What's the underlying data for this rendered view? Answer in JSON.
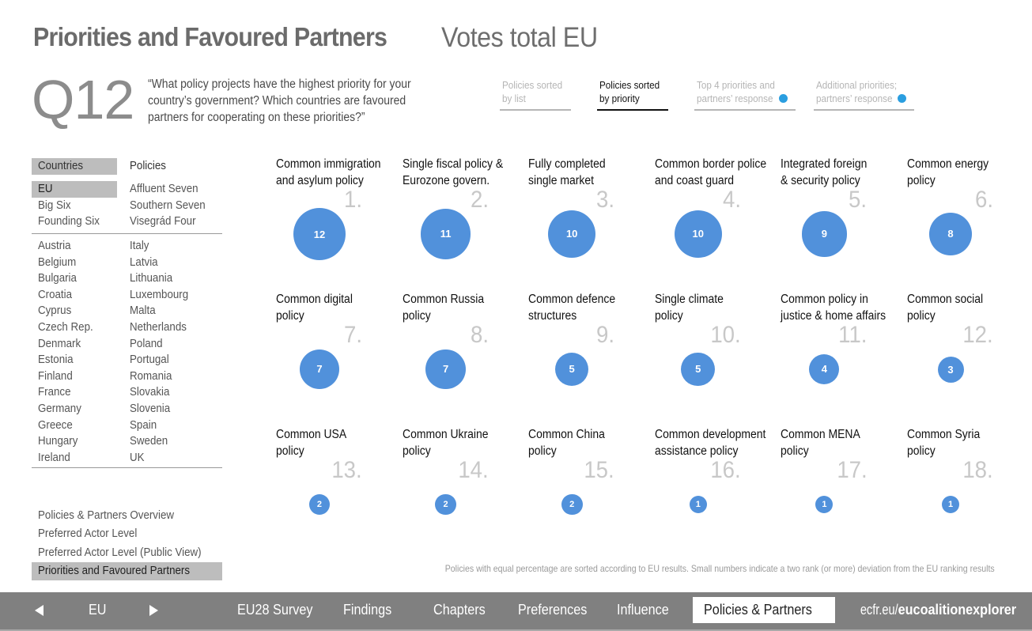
{
  "header": {
    "title": "Priorities and Favoured Partners",
    "subtitle": "Votes total EU",
    "question_number": "Q12",
    "question_text": "“What policy projects have the highest priority for your country’s government? Which countries are favoured partners for cooperating on these priorities?”"
  },
  "view_tabs": [
    {
      "line1": "Policies sorted",
      "line2": "by list",
      "active": false,
      "has_dot": false
    },
    {
      "line1": "Policies sorted",
      "line2": "by priority",
      "active": true,
      "has_dot": false
    },
    {
      "line1": "Top 4 priorities and",
      "line2": "partners’ response",
      "active": false,
      "has_dot": true
    },
    {
      "line1": "Additional priorities;",
      "line2": "partners’ response",
      "active": false,
      "has_dot": true
    }
  ],
  "sidebar": {
    "headers": {
      "countries": "Countries",
      "policies": "Policies",
      "selected": "Countries"
    },
    "groups_left": [
      "EU",
      "Big Six",
      "Founding Six"
    ],
    "groups_right": [
      "Affluent Seven",
      "Southern Seven",
      "Visegrád Four"
    ],
    "selected_group": "EU",
    "countries_left": [
      "Austria",
      "Belgium",
      "Bulgaria",
      "Croatia",
      "Cyprus",
      "Czech Rep.",
      "Denmark",
      "Estonia",
      "Finland",
      "France",
      "Germany",
      "Greece",
      "Hungary",
      "Ireland"
    ],
    "countries_right": [
      "Italy",
      "Latvia",
      "Lithuania",
      "Luxembourg",
      "Malta",
      "Netherlands",
      "Poland",
      "Portugal",
      "Romania",
      "Slovakia",
      "Slovenia",
      "Spain",
      "Sweden",
      "UK"
    ],
    "links": [
      "Policies & Partners Overview",
      "Preferred Actor Level",
      "Preferred Actor Level (Public View)",
      "Priorities and Favoured Partners"
    ],
    "selected_link": "Priorities and Favoured Partners"
  },
  "policies": [
    {
      "rank": "1.",
      "line1": "Common immigration",
      "line2": "and asylum policy",
      "votes": 12
    },
    {
      "rank": "2.",
      "line1": "Single fiscal policy &",
      "line2": "Eurozone govern.",
      "votes": 11
    },
    {
      "rank": "3.",
      "line1": "Fully completed",
      "line2": "single market",
      "votes": 10
    },
    {
      "rank": "4.",
      "line1": "Common border police",
      "line2": "and coast guard",
      "votes": 10
    },
    {
      "rank": "5.",
      "line1": "Integrated foreign",
      "line2": "& security policy",
      "votes": 9
    },
    {
      "rank": "6.",
      "line1": "Common energy",
      "line2": "policy",
      "votes": 8
    },
    {
      "rank": "7.",
      "line1": "Common digital",
      "line2": "policy",
      "votes": 7
    },
    {
      "rank": "8.",
      "line1": "Common Russia",
      "line2": "policy",
      "votes": 7
    },
    {
      "rank": "9.",
      "line1": "Common defence",
      "line2": "structures",
      "votes": 5
    },
    {
      "rank": "10.",
      "line1": "Single climate",
      "line2": "policy",
      "votes": 5
    },
    {
      "rank": "11.",
      "line1": "Common policy in",
      "line2": "justice & home affairs",
      "votes": 4
    },
    {
      "rank": "12.",
      "line1": "Common social",
      "line2": "policy",
      "votes": 3
    },
    {
      "rank": "13.",
      "line1": "Common USA",
      "line2": "policy",
      "votes": 2
    },
    {
      "rank": "14.",
      "line1": "Common Ukraine",
      "line2": "policy",
      "votes": 2
    },
    {
      "rank": "15.",
      "line1": "Common China",
      "line2": "policy",
      "votes": 2
    },
    {
      "rank": "16.",
      "line1": "Common development",
      "line2": "assistance policy",
      "votes": 1
    },
    {
      "rank": "17.",
      "line1": "Common MENA",
      "line2": "policy",
      "votes": 1
    },
    {
      "rank": "18.",
      "line1": "Common Syria",
      "line2": "policy",
      "votes": 1
    }
  ],
  "footnote": "Policies with equal percentage are sorted according to EU results. Small numbers indicate a two rank (or more) deviation from the EU ranking results",
  "bottom_nav": {
    "current_selection": "EU",
    "items": [
      "EU28 Survey",
      "Findings",
      "Chapters",
      "Preferences",
      "Influence",
      "Policies & Partners"
    ],
    "active_item": "Policies & Partners",
    "url_prefix": "ecfr.eu/",
    "url_bold": "eucoalitionexplorer"
  },
  "colors": {
    "bubble": "#5191db",
    "tab_dot": "#2a9ee0",
    "selected_bg": "#bdbdbd",
    "bottom_bar": "#808080",
    "rank_text": "#c8c8c8"
  }
}
